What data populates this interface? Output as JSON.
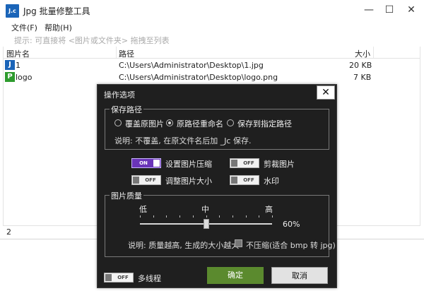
{
  "window": {
    "icon_text": "J.c",
    "title": "Jpg 批量修整工具",
    "min_glyph": "—",
    "max_glyph": "☐",
    "close_glyph": "✕"
  },
  "menu": {
    "file": "文件(F)",
    "help": "帮助(H)"
  },
  "hint": "提示: 可直接将 <图片或文件夹> 拖拽至列表",
  "list": {
    "columns": {
      "name": "图片名",
      "path": "路径",
      "size": "大小"
    },
    "rows": [
      {
        "icon": "J",
        "icon_color": "#1a64b8",
        "name": "1",
        "path": "C:\\Users\\Administrator\\Desktop\\1.jpg",
        "size": "20 KB"
      },
      {
        "icon": "P",
        "icon_color": "#2e9b2e",
        "name": "logo",
        "path": "C:\\Users\\Administrator\\Desktop\\logo.png",
        "size": "7 KB"
      }
    ]
  },
  "status": {
    "count": "2"
  },
  "dialog": {
    "title": "操作选项",
    "close_glyph": "✕",
    "save_path": {
      "label": "保存路径",
      "options": [
        "覆盖原图片",
        "原路径重命名",
        "保存到指定路径"
      ],
      "selected_index": 1,
      "desc": "说明: 不覆盖, 在原文件名后加 _Jc 保存."
    },
    "toggles": {
      "compress": {
        "label": "设置图片压缩",
        "state": "ON",
        "on": true
      },
      "crop": {
        "label": "剪裁图片",
        "state": "OFF",
        "on": false
      },
      "resize": {
        "label": "调整图片大小",
        "state": "OFF",
        "on": false
      },
      "watermark": {
        "label": "水印",
        "state": "OFF",
        "on": false
      },
      "multithread": {
        "label": "多线程",
        "state": "OFF",
        "on": false
      }
    },
    "quality": {
      "label": "图片质量",
      "low": "低",
      "mid": "中",
      "high": "高",
      "value_text": "60%",
      "value": 0.6,
      "desc": "说明: 质量越高, 生成的大小越大",
      "no_compress_label": "不压缩(适合 bmp 转 jpg)",
      "no_compress_checked": false
    },
    "ok": "确定",
    "cancel": "取消"
  },
  "colors": {
    "dialog_bg": "#1f1f1f",
    "ok_green": "#5b8a2e",
    "toggle_on": "#6a34b8"
  }
}
